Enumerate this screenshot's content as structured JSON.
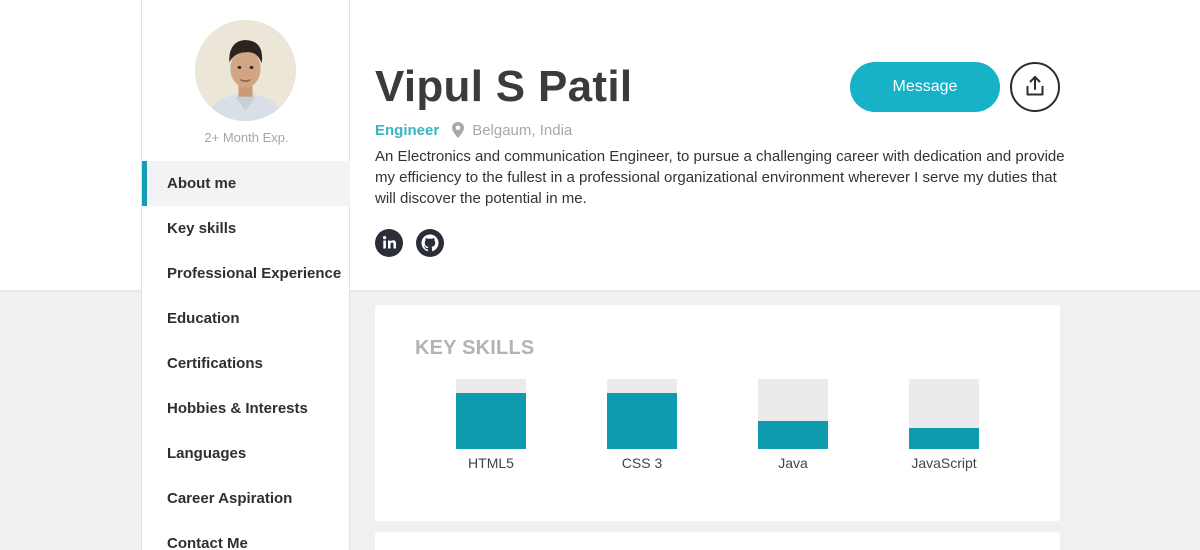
{
  "profile": {
    "name": "Vipul S Patil",
    "role": "Engineer",
    "location": "Belgaum, India",
    "experience": "2+ Month Exp.",
    "bio": "An Electronics and communication Engineer, to pursue a challenging career with dedication and provide my efficiency to the fullest in a professional organizational environment wherever I serve my duties that will discover the potential in me."
  },
  "actions": {
    "message_label": "Message",
    "share_icon": "share-upload-icon"
  },
  "social": {
    "icons": [
      "linkedin-icon",
      "github-icon"
    ]
  },
  "sidebar": {
    "items": [
      {
        "label": "About me",
        "active": true
      },
      {
        "label": "Key skills"
      },
      {
        "label": "Professional Experience"
      },
      {
        "label": "Education"
      },
      {
        "label": "Certifications"
      },
      {
        "label": "Hobbies & Interests"
      },
      {
        "label": "Languages"
      },
      {
        "label": "Career Aspiration"
      },
      {
        "label": "Contact Me"
      }
    ]
  },
  "skills": {
    "title": "KEY SKILLS",
    "items": [
      {
        "label": "HTML5",
        "level": 0.8
      },
      {
        "label": "CSS 3",
        "level": 0.8
      },
      {
        "label": "Java",
        "level": 0.4
      },
      {
        "label": "JavaScript",
        "level": 0.3
      }
    ]
  },
  "colors": {
    "accent": "#17b1c8",
    "bar_fill": "#0f9aad",
    "bar_track": "#ebebee",
    "role_text": "#3bb3c3"
  }
}
